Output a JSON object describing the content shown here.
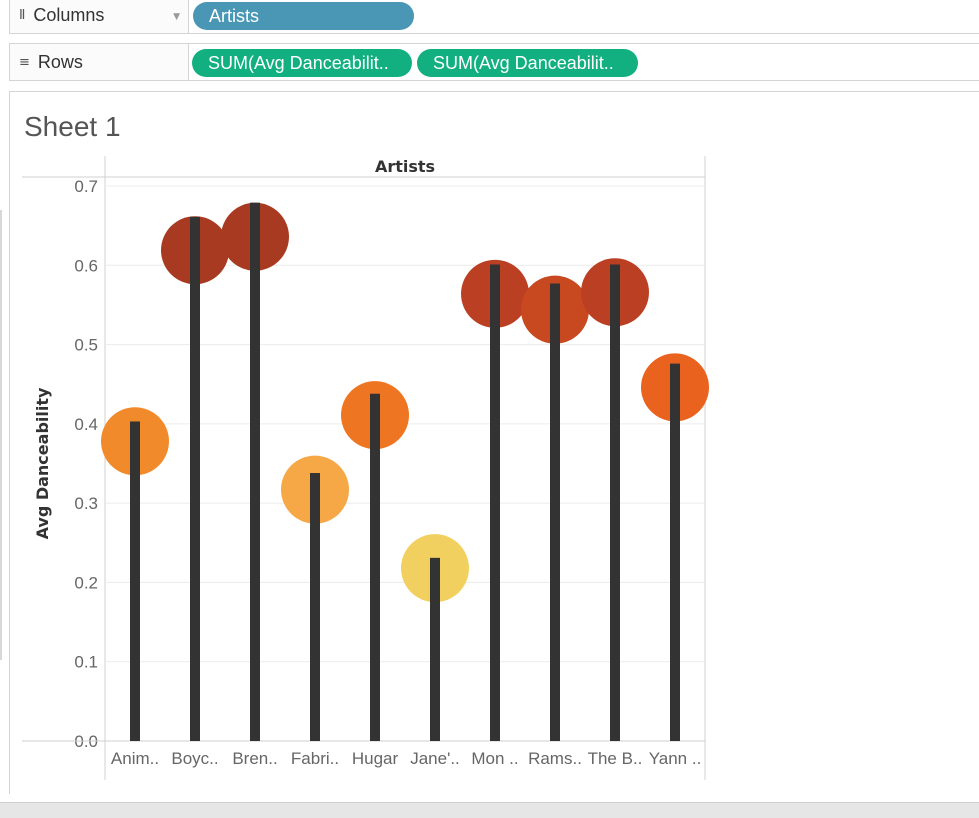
{
  "columns_shelf": {
    "label": "Columns",
    "icon": "columns-icon",
    "pills": [
      "Artists"
    ]
  },
  "rows_shelf": {
    "label": "Rows",
    "icon": "rows-icon",
    "pills": [
      "SUM(Avg Danceabilit..",
      "SUM(Avg Danceabilit.."
    ]
  },
  "sheet": {
    "title": "Sheet 1"
  },
  "colors": {
    "dimension_pill": "#4a96b5",
    "measure_pill": "#12b081",
    "stick": "#333333"
  },
  "chart_data": {
    "type": "bar",
    "header": "Artists",
    "ylabel": "Avg Danceability",
    "ylim": [
      0,
      0.7
    ],
    "yticks": [
      0.0,
      0.1,
      0.2,
      0.3,
      0.4,
      0.5,
      0.6,
      0.7
    ],
    "ytick_labels": [
      "0.0",
      "0.1",
      "0.2",
      "0.3",
      "0.4",
      "0.5",
      "0.6",
      "0.7"
    ],
    "grid": true,
    "categories": [
      "Anim..",
      "Boyc..",
      "Bren..",
      "Fabri..",
      "Hugar",
      "Jane'..",
      "Mon ..",
      "Rams..",
      "The B..",
      "Yann .."
    ],
    "series": [
      {
        "mark": "bar",
        "values": [
          0.403,
          0.661,
          0.679,
          0.338,
          0.438,
          0.231,
          0.601,
          0.577,
          0.601,
          0.476
        ]
      },
      {
        "mark": "circle",
        "values": [
          0.378,
          0.619,
          0.636,
          0.317,
          0.411,
          0.218,
          0.564,
          0.544,
          0.566,
          0.446
        ]
      }
    ],
    "circle_colors": [
      "#f08a2a",
      "#a83a22",
      "#a83a22",
      "#f6a847",
      "#ee7522",
      "#f2d060",
      "#bb3f23",
      "#c8481f",
      "#bb3f23",
      "#e9631f"
    ]
  }
}
